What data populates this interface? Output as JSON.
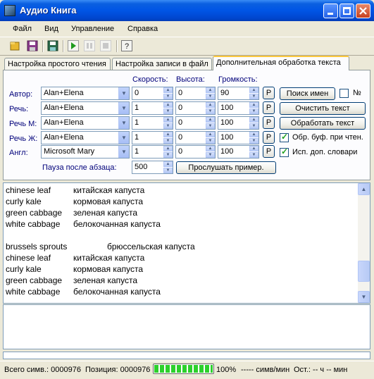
{
  "window": {
    "title": "Аудио Книга"
  },
  "menu": [
    "Файл",
    "Вид",
    "Управление",
    "Справка"
  ],
  "toolbar": [
    "open-icon",
    "save-icon",
    "save-audio-icon",
    "play-icon",
    "pause-icon",
    "stop-icon",
    "help-icon"
  ],
  "tabs": [
    "Настройка простого чтения",
    "Настройка записи в файл",
    "Дополнительная обработка текста"
  ],
  "headers": {
    "speed": "Скорость:",
    "pitch": "Высота:",
    "volume": "Громкость:"
  },
  "voices": [
    {
      "label": "Автор:",
      "voice": "Alan+Elena",
      "speed": "0",
      "pitch": "0",
      "volume": "90"
    },
    {
      "label": "Речь:",
      "voice": "Alan+Elena",
      "speed": "1",
      "pitch": "0",
      "volume": "100"
    },
    {
      "label": "Речь М:",
      "voice": "Alan+Elena",
      "speed": "1",
      "pitch": "0",
      "volume": "100"
    },
    {
      "label": "Речь Ж:",
      "voice": "Alan+Elena",
      "speed": "1",
      "pitch": "0",
      "volume": "100"
    },
    {
      "label": "Англ:",
      "voice": "Microsoft Mary",
      "speed": "1",
      "pitch": "0",
      "volume": "100"
    }
  ],
  "p_label": "P",
  "buttons": {
    "search_names": "Поиск имен",
    "clear_text": "Очистить текст",
    "process_text": "Обработать текст",
    "listen_sample": "Прослушать пример."
  },
  "checks": {
    "number_sign": {
      "label": "№",
      "checked": false
    },
    "buffer_processing": {
      "label": "Обр. буф. при чтен.",
      "checked": true
    },
    "extra_dicts": {
      "label": "Исп. доп. словари",
      "checked": true
    }
  },
  "pause": {
    "label": "Пауза после абзаца:",
    "value": "500"
  },
  "text_lines": [
    {
      "en": "chinese leaf",
      "ru": "китайская капуста"
    },
    {
      "en": "curly kale",
      "ru": "кормовая капуста"
    },
    {
      "en": "green cabbage",
      "ru": "зеленая капуста"
    },
    {
      "en": "white cabbage",
      "ru": "белокочанная капуста"
    },
    {
      "en": "",
      "ru": ""
    },
    {
      "en": "brussels sprouts",
      "ru": "брюссельская капуста"
    },
    {
      "en": "chinese leaf",
      "ru": "китайская капуста"
    },
    {
      "en": "curly kale",
      "ru": "кормовая капуста"
    },
    {
      "en": "green cabbage",
      "ru": "зеленая капуста"
    },
    {
      "en": "white cabbage",
      "ru": "белокочанная капуста"
    }
  ],
  "status": {
    "total": "Всего симв.: 0000976",
    "position": "Позиция: 0000976",
    "progress_percent": 100,
    "percent_text": "100%",
    "rate": "----- симв/мин",
    "remaining": "Ост.: -- ч -- мин"
  }
}
